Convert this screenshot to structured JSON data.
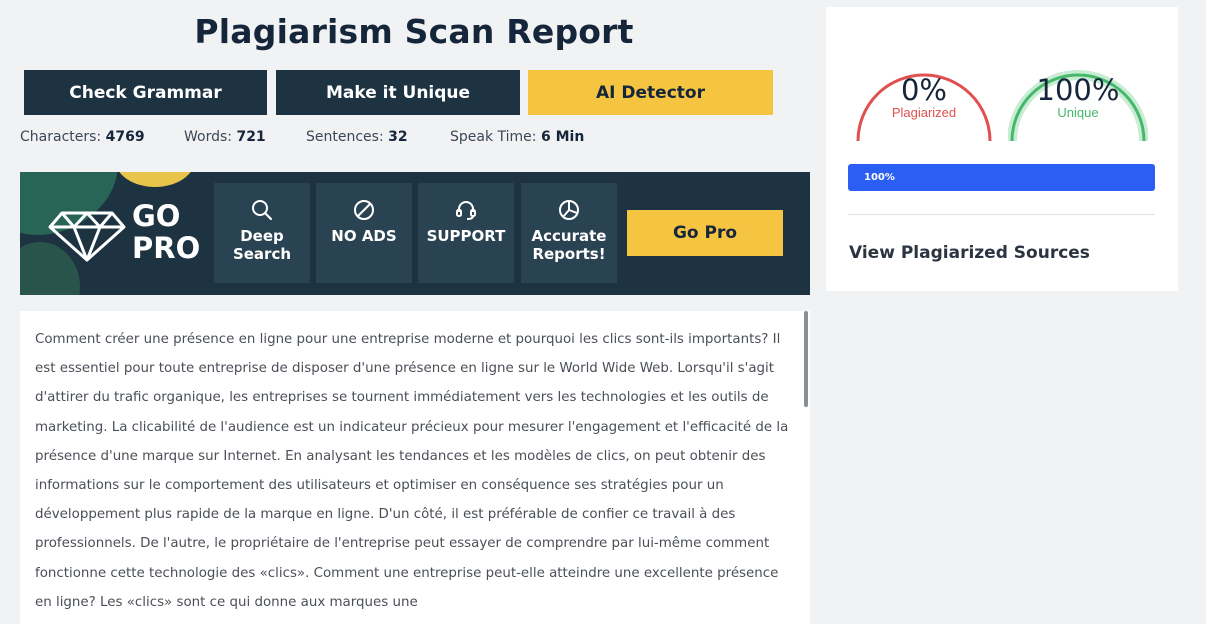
{
  "page_title": "Plagiarism Scan Report",
  "actions": {
    "check_grammar": "Check Grammar",
    "make_unique": "Make it Unique",
    "ai_detector": "AI Detector"
  },
  "stats": {
    "characters_label": "Characters:",
    "characters_value": "4769",
    "words_label": "Words:",
    "words_value": "721",
    "sentences_label": "Sentences:",
    "sentences_value": "32",
    "speak_label": "Speak Time:",
    "speak_value": "6 Min"
  },
  "promo": {
    "go": "GO",
    "pro": "PRO",
    "features": [
      {
        "line1": "Deep",
        "line2": "Search",
        "icon": "search-icon"
      },
      {
        "line1": "NO ADS",
        "line2": "",
        "icon": "ban-icon"
      },
      {
        "line1": "SUPPORT",
        "line2": "",
        "icon": "headset-icon"
      },
      {
        "line1": "Accurate",
        "line2": "Reports!",
        "icon": "pie-chart-icon"
      }
    ],
    "button": "Go Pro"
  },
  "content": {
    "text": "Comment créer une présence en ligne pour une entreprise moderne et pourquoi les clics sont-ils importants? Il est essentiel pour toute entreprise de disposer d'une présence en ligne sur le World Wide Web. Lorsqu'il s'agit d'attirer du trafic organique, les entreprises se tournent immédiatement vers les technologies et les outils de marketing. La clicabilité de l'audience est un indicateur précieux pour mesurer l'engagement et l'efficacité de la présence d'une marque sur Internet. En analysant les tendances et les modèles de clics, on peut obtenir des informations sur le comportement des utilisateurs et optimiser en conséquence ses stratégies pour un développement plus rapide de la marque en ligne. D'un côté, il est préférable de confier ce travail à des professionnels. De l'autre, le propriétaire de l'entreprise peut essayer de comprendre par lui-même comment fonctionne cette technologie des «clics». Comment une entreprise peut-elle atteindre une excellente présence en ligne? Les «clics» sont ce qui donne aux marques une"
  },
  "results": {
    "plagiarized_percent": "0%",
    "plagiarized_label": "Plagiarized",
    "unique_percent": "100%",
    "unique_label": "Unique",
    "progress_label": "100%",
    "progress_value": 1.0,
    "view_sources": "View Plagiarized Sources"
  },
  "colors": {
    "navy": "#1d3342",
    "yellow": "#f5c542",
    "red": "#e0504f",
    "green": "#46b86b",
    "blue": "#2b5ff3"
  }
}
